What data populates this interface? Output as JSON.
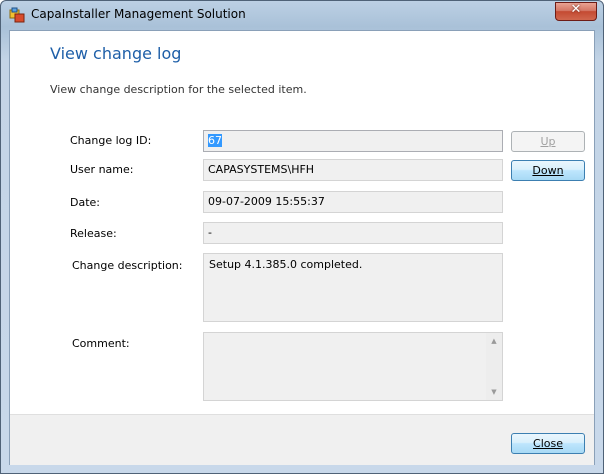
{
  "window": {
    "title": "CapaInstaller Management Solution",
    "close_glyph": "✕"
  },
  "header": {
    "title": "View change log",
    "subtitle": "View change description for the selected item."
  },
  "form": {
    "change_log_id_label": "Change log ID:",
    "change_log_id_value": "67",
    "user_name_label": "User name:",
    "user_name_value": "CAPASYSTEMS\\HFH",
    "date_label": "Date:",
    "date_value": "09-07-2009 15:55:37",
    "release_label": "Release:",
    "release_value": "-",
    "change_description_label": "Change description:",
    "change_description_value": "Setup 4.1.385.0 completed.",
    "comment_label": "Comment:",
    "comment_value": ""
  },
  "buttons": {
    "up_label": "Up",
    "down_label": "Down",
    "close_label": "Close"
  },
  "icons": {
    "app": "capainstaller-app-icon",
    "scroll_up": "▲",
    "scroll_down": "▼"
  },
  "colors": {
    "title_accent": "#1e5fa8",
    "selection": "#3399ff",
    "close_button": "#c44a32"
  }
}
